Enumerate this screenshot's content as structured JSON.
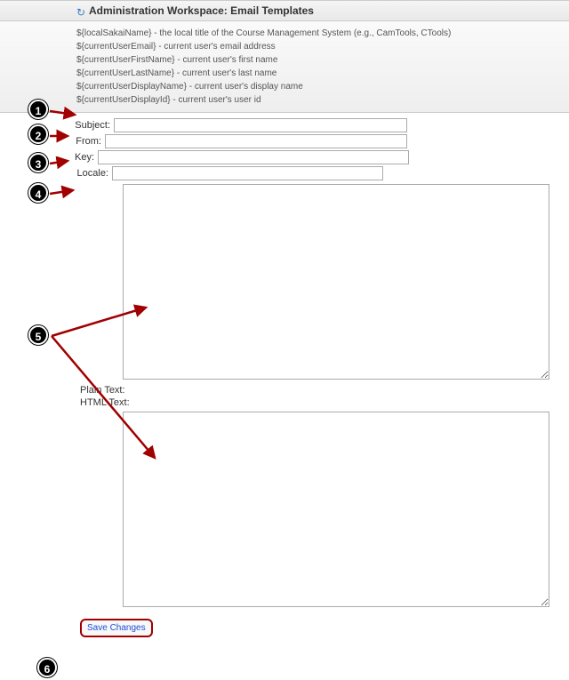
{
  "header": {
    "title": "Administration Workspace: Email Templates"
  },
  "info_lines": [
    "${localSakaiName} - the local title of the Course Management System (e.g., CamTools, CTools)",
    "${currentUserEmail} - current user's email address",
    "${currentUserFirstName} - current user's first name",
    "${currentUserLastName} - current user's last name",
    "${currentUserDisplayName} - current user's display name",
    "${currentUserDisplayId} - current user's user id"
  ],
  "form": {
    "subject_label": "Subject:",
    "subject_value": "",
    "from_label": "From:",
    "from_value": "",
    "key_label": "Key:",
    "key_value": "",
    "locale_label": "Locale:",
    "locale_value": "",
    "plain_text_label": "Plain Text:",
    "html_text_label": "HTML Text:",
    "plain_text_value": "",
    "html_text_value": ""
  },
  "buttons": {
    "save": "Save Changes"
  },
  "callouts": {
    "c1": "1",
    "c2": "2",
    "c3": "3",
    "c4": "4",
    "c5": "5",
    "c6": "6"
  }
}
